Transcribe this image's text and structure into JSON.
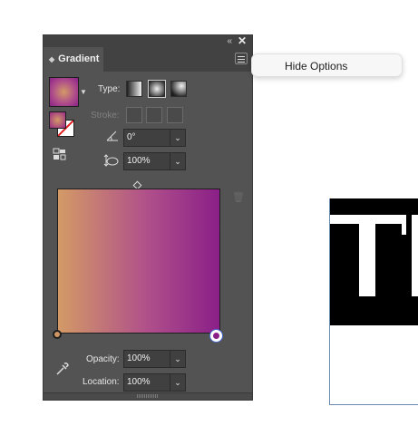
{
  "panel": {
    "title": "Gradient",
    "collapse_glyph": "«",
    "close_glyph": "✕",
    "type_label": "Type:",
    "stroke_label": "Stroke:",
    "angle_value": "0°",
    "aspect_value": "100%",
    "opacity_label": "Opacity:",
    "opacity_value": "100%",
    "location_label": "Location:",
    "location_value": "100%",
    "dropdown_glyph": "⌄"
  },
  "menu": {
    "hide_options": "Hide Options"
  },
  "colors": {
    "gradient_start": "#d39a66",
    "gradient_mid": "#b0508a",
    "gradient_end": "#8a1f88",
    "panel_bg": "#535353"
  },
  "icons": [
    "collapse-icon",
    "close-icon",
    "panel-menu-icon",
    "gradient-swatch",
    "fill-swatch",
    "stroke-swatch",
    "swap-icon",
    "linear-gradient-icon",
    "radial-gradient-icon",
    "freeform-gradient-icon",
    "angle-icon",
    "aspect-ratio-icon",
    "delete-stop-icon",
    "eyedropper-icon",
    "midpoint-diamond-icon"
  ]
}
